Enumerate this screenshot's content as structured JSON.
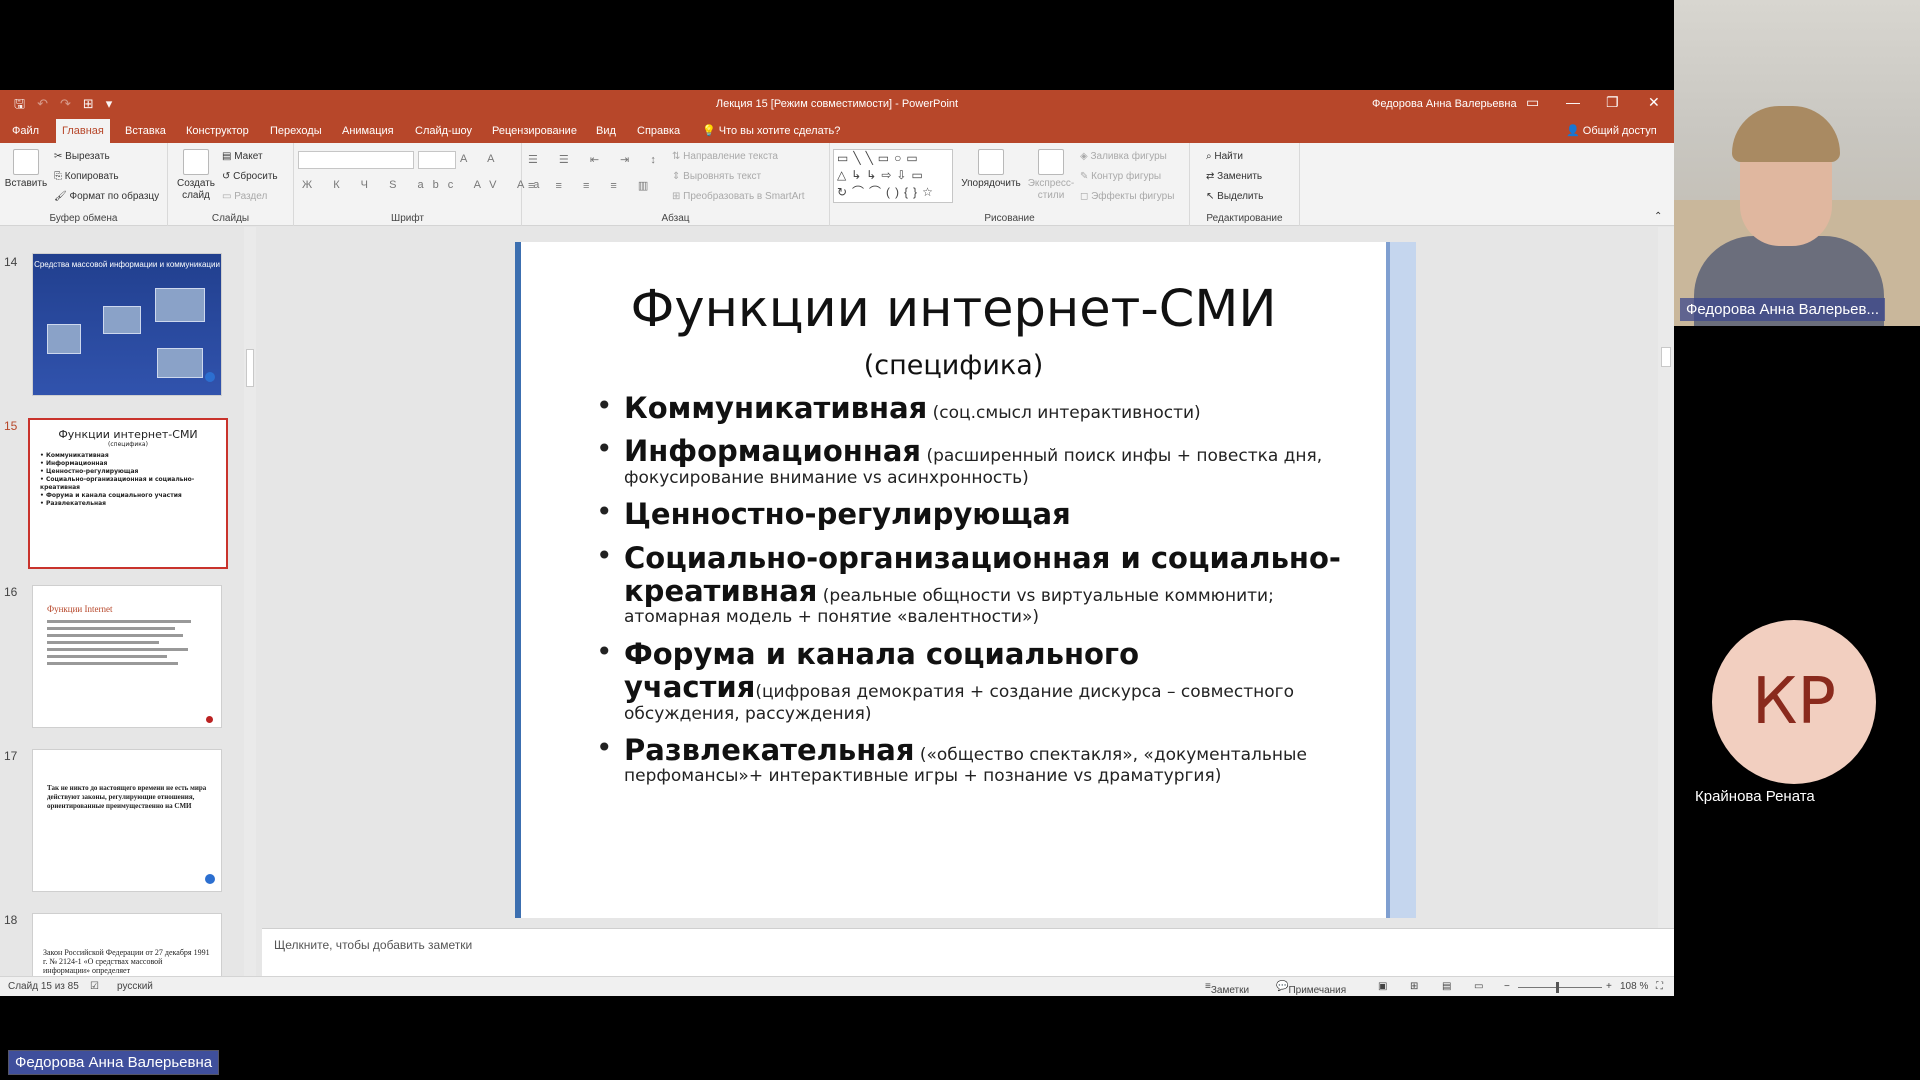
{
  "window": {
    "title": "Лекция 15 [Режим совместимости]  -  PowerPoint",
    "user": "Федорова Анна Валерьевна",
    "controls": [
      "▭",
      "—",
      "❐",
      "✕"
    ]
  },
  "qat": {
    "save": "🖫",
    "undo": "↶",
    "redo": "↷",
    "start": "⊞",
    "more": "▾"
  },
  "tabs": [
    "Файл",
    "Главная",
    "Вставка",
    "Конструктор",
    "Переходы",
    "Анимация",
    "Слайд-шоу",
    "Рецензирование",
    "Вид",
    "Справка",
    "Что вы хотите сделать?"
  ],
  "share_label": "Общий доступ",
  "ribbon": {
    "clipboard": {
      "paste": "Вставить",
      "cut": "Вырезать",
      "copy": "Копировать",
      "format": "Формат по образцу",
      "label": "Буфер обмена"
    },
    "slides": {
      "new_slide": "Создать слайд",
      "layout": "Макет",
      "reset": "Сбросить",
      "section": "Раздел",
      "label": "Слайды"
    },
    "font": {
      "label": "Шрифт",
      "icons": "Ж К Ч S abc AV Aa"
    },
    "paragraph": {
      "text_direction": "Направление текста",
      "align_text": "Выровнять текст",
      "smartart": "Преобразовать в SmartArt",
      "label": "Абзац"
    },
    "drawing": {
      "arrange": "Упорядочить",
      "quick_styles": "Экспресс-стили",
      "fill": "Заливка фигуры",
      "outline": "Контур фигуры",
      "effects": "Эффекты фигуры",
      "label": "Рисование"
    },
    "editing": {
      "find": "Найти",
      "replace": "Заменить",
      "select": "Выделить",
      "label": "Редактирование"
    }
  },
  "thumbnails": {
    "numbers": [
      "14",
      "15",
      "16",
      "17",
      "18"
    ],
    "t14_title": "Средства массовой информации и коммуникации",
    "t15_title": "Функции интернет-СМИ",
    "t15_sub": "(специфика)",
    "t15_items": [
      "Коммуникативная",
      "Информационная",
      "Ценностно-регулирующая",
      "Социально-организационная и социально-креативная",
      "Форума и канала социального участия",
      "Развлекательная"
    ],
    "t16_title": "Функции Internet",
    "t17_text": "Так не никто до настоящего времени не есть мира действуют законы, регулирующие отношения, ориентированные преимущественно на СМИ",
    "t18_text": "Закон Российской Федерации от 27 декабря 1991 г. № 2124-1 «О средствах массовой информации» определяет"
  },
  "slide": {
    "title": "Функции интернет-СМИ",
    "subtitle": "(специфика)",
    "bullets": [
      {
        "bold": "Коммуникативная",
        "note": " (соц.смысл интерактивности)"
      },
      {
        "bold": "Информационная",
        "note": " (расширенный поиск инфы + повестка дня, фокусирование внимание vs асинхронность)"
      },
      {
        "bold": "Ценностно-регулирующая",
        "note": ""
      },
      {
        "bold": "Социально-организационная и социально-креативная",
        "note": " (реальные общности vs виртуальные коммюнити; атомарная модель + понятие «валентности»)"
      },
      {
        "bold": "Форума и канала социального участия",
        "note": "(цифровая демократия + создание дискурса – совместного обсуждения, рассуждения)"
      },
      {
        "bold": "Развлекательная",
        "note": " («общество спектакля», «документальные перфомансы»+ интерактивные игры + познание vs драматургия)"
      }
    ]
  },
  "notes_placeholder": "Щелкните, чтобы добавить заметки",
  "status": {
    "slide_info": "Слайд 15 из 85",
    "language": "русский",
    "notes": "Заметки",
    "comments": "Примечания",
    "zoom": "108 %"
  },
  "video": {
    "presenter_name": "Федорова Анна Валерьев...",
    "participant_initials": "КР",
    "participant_name": "Крайнова Рената",
    "self_label": "Федорова Анна Валерьевна"
  },
  "colors": {
    "accent": "#b7472a",
    "avatar_bg": "#f2cfc0",
    "selection": "#c9332c"
  }
}
